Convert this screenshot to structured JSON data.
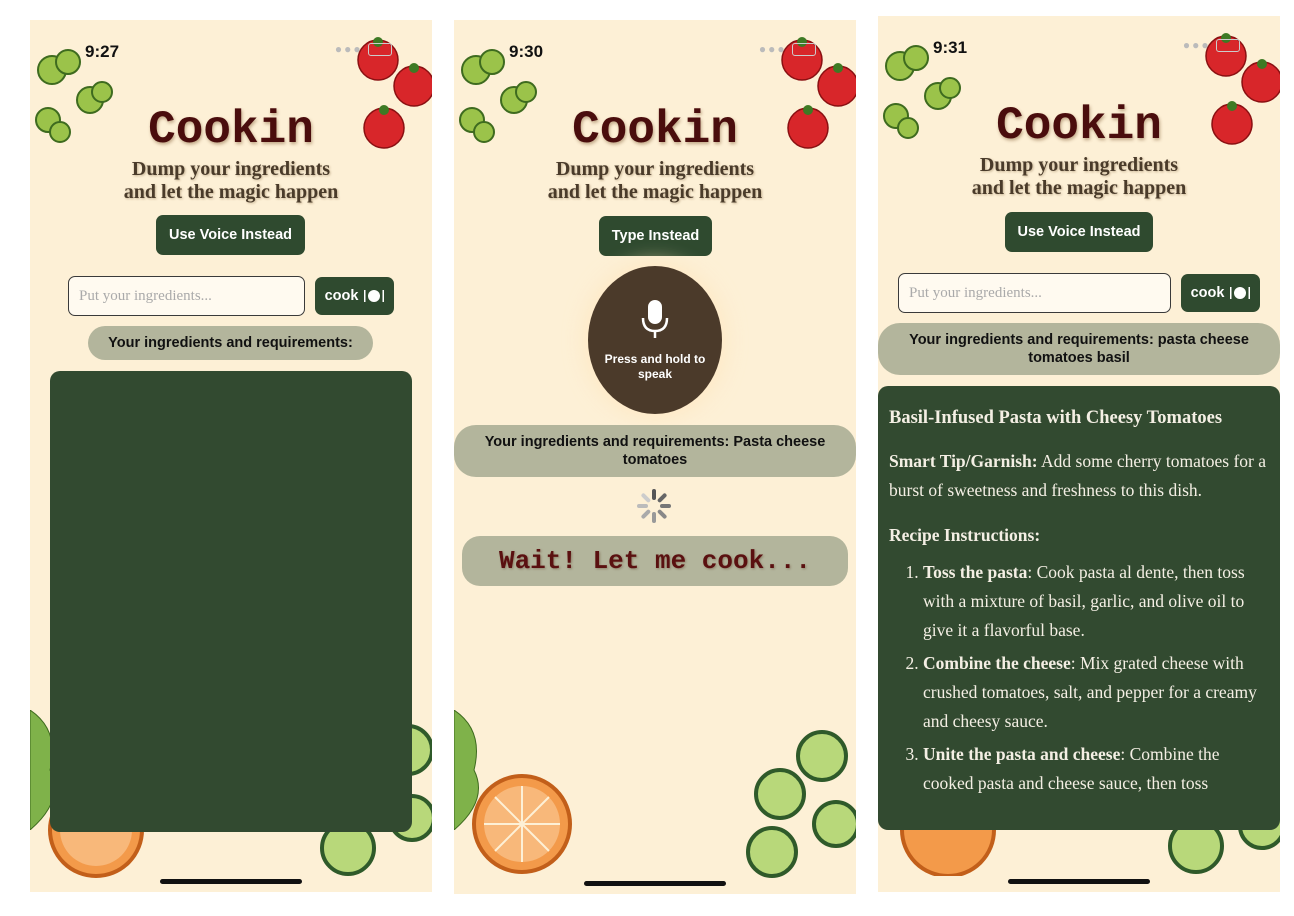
{
  "screens": [
    {
      "time": "9:27",
      "title": "Cookin",
      "subtitle_line1": "Dump your ingredients",
      "subtitle_line2": "and let the magic happen",
      "toggle_button": "Use Voice Instead",
      "input_placeholder": "Put your ingredients...",
      "cook_button": "cook",
      "ingredients_label": "Your ingredients and requirements:"
    },
    {
      "time": "9:30",
      "title": "Cookin",
      "subtitle_line1": "Dump your ingredients",
      "subtitle_line2": "and let the magic happen",
      "toggle_button": "Type Instead",
      "mic_label": "Press and hold to speak",
      "ingredients_label": "Your ingredients and requirements: Pasta cheese tomatoes",
      "wait_text": "Wait! Let me cook..."
    },
    {
      "time": "9:31",
      "title": "Cookin",
      "subtitle_line1": "Dump your ingredients",
      "subtitle_line2": "and let the magic happen",
      "toggle_button": "Use Voice Instead",
      "input_placeholder": "Put your ingredients...",
      "cook_button": "cook",
      "ingredients_label": "Your ingredients and requirements: pasta cheese tomatoes basil",
      "recipe": {
        "title": "Basil-Infused Pasta with Cheesy Tomatoes",
        "tip_label": "Smart Tip/Garnish:",
        "tip_text": " Add some cherry tomatoes for a burst of sweetness and freshness to this dish.",
        "instructions_heading": "Recipe Instructions:",
        "steps": [
          {
            "bold": "Toss the pasta",
            "text": ": Cook pasta al dente, then toss with a mixture of basil, garlic, and olive oil to give it a flavorful base."
          },
          {
            "bold": "Combine the cheese",
            "text": ": Mix grated cheese with crushed tomatoes, salt, and pepper for a creamy and cheesy sauce."
          },
          {
            "bold": "Unite the pasta and cheese",
            "text": ": Combine the cooked pasta and cheese sauce, then toss"
          }
        ]
      }
    }
  ],
  "colors": {
    "background": "#fdf0d6",
    "dark_green": "#2f4a2f",
    "pill": "#b3b59c",
    "title": "#4a0d0d",
    "mic": "#4b3a2a"
  },
  "icons": [
    "wifi-icon",
    "battery-icon",
    "plate-icon",
    "microphone-icon",
    "loading-spinner-icon",
    "broccoli-icon",
    "tomato-icon",
    "orange-slice-icon",
    "cucumber-slice-icon",
    "lettuce-icon"
  ]
}
